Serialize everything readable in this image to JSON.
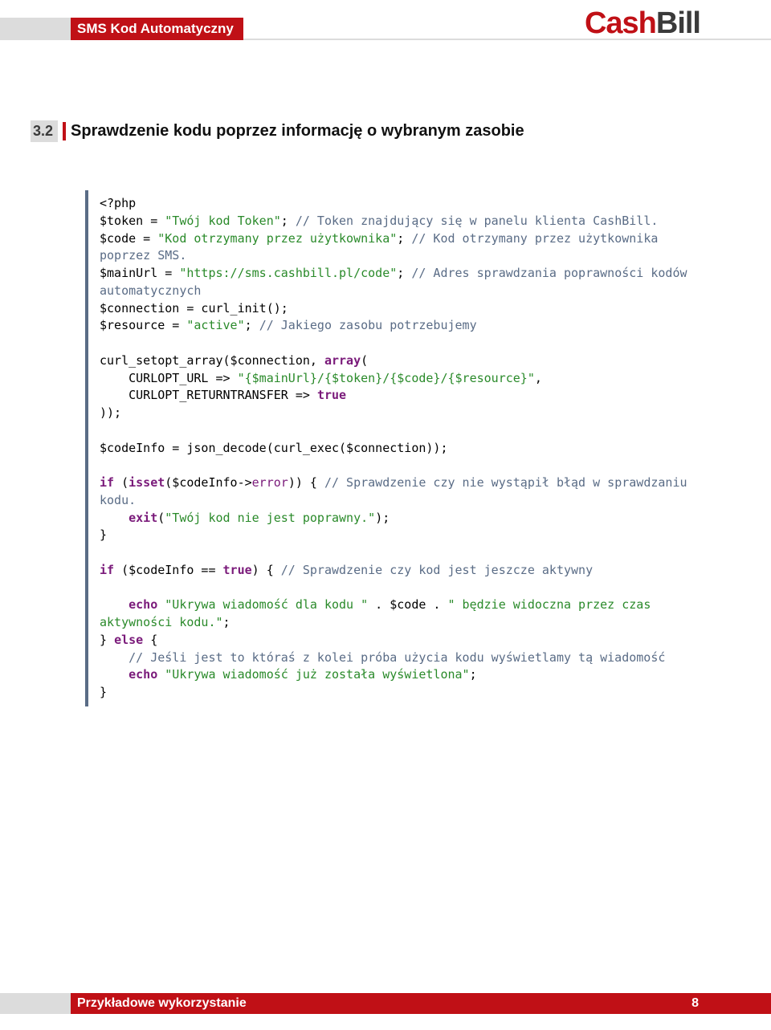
{
  "header": {
    "doc_title": "SMS Kod Automatyczny",
    "logo_part1": "Cash",
    "logo_part2": "Bill"
  },
  "section": {
    "number": "3.2",
    "title": "Sprawdzenie kodu poprzez informację o wybranym zasobie"
  },
  "code": {
    "tokens": [
      {
        "t": "<?php\n",
        "c": "c-default"
      },
      {
        "t": "$token = ",
        "c": "c-default"
      },
      {
        "t": "\"Twój kod Token\"",
        "c": "c-string"
      },
      {
        "t": "; ",
        "c": "c-default"
      },
      {
        "t": "// Token znajdujący się w panelu klienta CashBill.",
        "c": "c-comment"
      },
      {
        "t": "\n",
        "c": "c-default"
      },
      {
        "t": "$code = ",
        "c": "c-default"
      },
      {
        "t": "\"Kod otrzymany przez użytkownika\"",
        "c": "c-string"
      },
      {
        "t": "; ",
        "c": "c-default"
      },
      {
        "t": "// Kod otrzymany przez użytkownika poprzez SMS.",
        "c": "c-comment"
      },
      {
        "t": "\n",
        "c": "c-default"
      },
      {
        "t": "$mainUrl = ",
        "c": "c-default"
      },
      {
        "t": "\"https://sms.cashbill.pl/code\"",
        "c": "c-string"
      },
      {
        "t": "; ",
        "c": "c-default"
      },
      {
        "t": "// Adres sprawdzania poprawności kodów automatycznych",
        "c": "c-comment"
      },
      {
        "t": "\n",
        "c": "c-default"
      },
      {
        "t": "$connection = curl_init();\n",
        "c": "c-default"
      },
      {
        "t": "$resource = ",
        "c": "c-default"
      },
      {
        "t": "\"active\"",
        "c": "c-string"
      },
      {
        "t": "; ",
        "c": "c-default"
      },
      {
        "t": "// Jakiego zasobu potrzebujemy",
        "c": "c-comment"
      },
      {
        "t": "\n\n",
        "c": "c-default"
      },
      {
        "t": "curl_setopt_array($connection, ",
        "c": "c-default"
      },
      {
        "t": "array",
        "c": "c-keyword"
      },
      {
        "t": "(\n",
        "c": "c-default"
      },
      {
        "t": "    CURLOPT_URL => ",
        "c": "c-default"
      },
      {
        "t": "\"{$mainUrl}/{$token}/{$code}/{$resource}\"",
        "c": "c-string"
      },
      {
        "t": ",\n",
        "c": "c-default"
      },
      {
        "t": "    CURLOPT_RETURNTRANSFER => ",
        "c": "c-default"
      },
      {
        "t": "true",
        "c": "c-keyword"
      },
      {
        "t": "\n",
        "c": "c-default"
      },
      {
        "t": "));\n\n",
        "c": "c-default"
      },
      {
        "t": "$codeInfo = json_decode(curl_exec($connection));\n\n",
        "c": "c-default"
      },
      {
        "t": "if",
        "c": "c-keyword"
      },
      {
        "t": " (",
        "c": "c-default"
      },
      {
        "t": "isset",
        "c": "c-keyword"
      },
      {
        "t": "($codeInfo->",
        "c": "c-default"
      },
      {
        "t": "error",
        "c": "c-member"
      },
      {
        "t": ")) { ",
        "c": "c-default"
      },
      {
        "t": "// Sprawdzenie czy nie wystąpił błąd w sprawdzaniu kodu.",
        "c": "c-comment"
      },
      {
        "t": "\n",
        "c": "c-default"
      },
      {
        "t": "    ",
        "c": "c-default"
      },
      {
        "t": "exit",
        "c": "c-keyword"
      },
      {
        "t": "(",
        "c": "c-default"
      },
      {
        "t": "\"Twój kod nie jest poprawny.\"",
        "c": "c-string"
      },
      {
        "t": ");\n",
        "c": "c-default"
      },
      {
        "t": "}\n\n",
        "c": "c-default"
      },
      {
        "t": "if",
        "c": "c-keyword"
      },
      {
        "t": " ($codeInfo == ",
        "c": "c-default"
      },
      {
        "t": "true",
        "c": "c-keyword"
      },
      {
        "t": ") { ",
        "c": "c-default"
      },
      {
        "t": "// Sprawdzenie czy kod jest jeszcze aktywny",
        "c": "c-comment"
      },
      {
        "t": "\n\n",
        "c": "c-default"
      },
      {
        "t": "    ",
        "c": "c-default"
      },
      {
        "t": "echo",
        "c": "c-keyword"
      },
      {
        "t": " ",
        "c": "c-default"
      },
      {
        "t": "\"Ukrywa wiadomość dla kodu \"",
        "c": "c-string"
      },
      {
        "t": " . $code . ",
        "c": "c-default"
      },
      {
        "t": "\" będzie widoczna przez czas aktywności kodu.\"",
        "c": "c-string"
      },
      {
        "t": ";\n",
        "c": "c-default"
      },
      {
        "t": "} ",
        "c": "c-default"
      },
      {
        "t": "else",
        "c": "c-keyword"
      },
      {
        "t": " {\n",
        "c": "c-default"
      },
      {
        "t": "    ",
        "c": "c-default"
      },
      {
        "t": "// Jeśli jest to któraś z kolei próba użycia kodu wyświetlamy tą wiadomość",
        "c": "c-comment"
      },
      {
        "t": "\n",
        "c": "c-default"
      },
      {
        "t": "    ",
        "c": "c-default"
      },
      {
        "t": "echo",
        "c": "c-keyword"
      },
      {
        "t": " ",
        "c": "c-default"
      },
      {
        "t": "\"Ukrywa wiadomość już została wyświetlona\"",
        "c": "c-string"
      },
      {
        "t": ";\n",
        "c": "c-default"
      },
      {
        "t": "}\n",
        "c": "c-default"
      }
    ]
  },
  "footer": {
    "label": "Przykładowe wykorzystanie",
    "page": "8"
  }
}
